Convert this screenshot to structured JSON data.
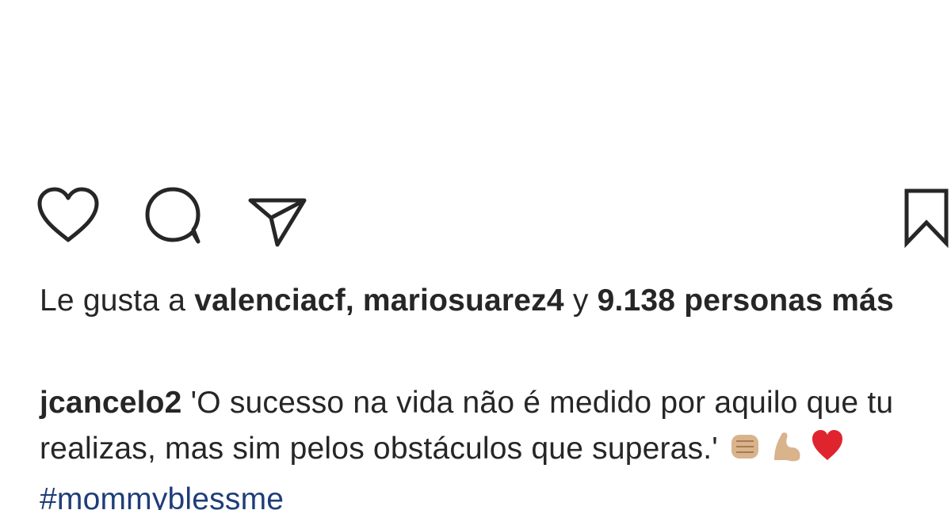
{
  "post": {
    "icons": {
      "like": "heart-outline-icon",
      "comment": "speech-bubble-icon",
      "share": "paper-plane-icon",
      "save": "bookmark-icon"
    },
    "likes": {
      "prefix": "Le gusta a",
      "user1": "valenciacf,",
      "user2": "mariosuarez4",
      "conj": "y",
      "count": "9.138",
      "suffix": "personas más"
    },
    "caption": {
      "username": "jcancelo2",
      "text": "'O sucesso na vida não é medido por aquilo que tu realizas, mas sim pelos obstáculos que superas.'",
      "emojis": [
        "fist-bump-emoji",
        "flexed-biceps-emoji",
        "red-heart-emoji"
      ],
      "hashtag": "#mommyblessme"
    }
  }
}
